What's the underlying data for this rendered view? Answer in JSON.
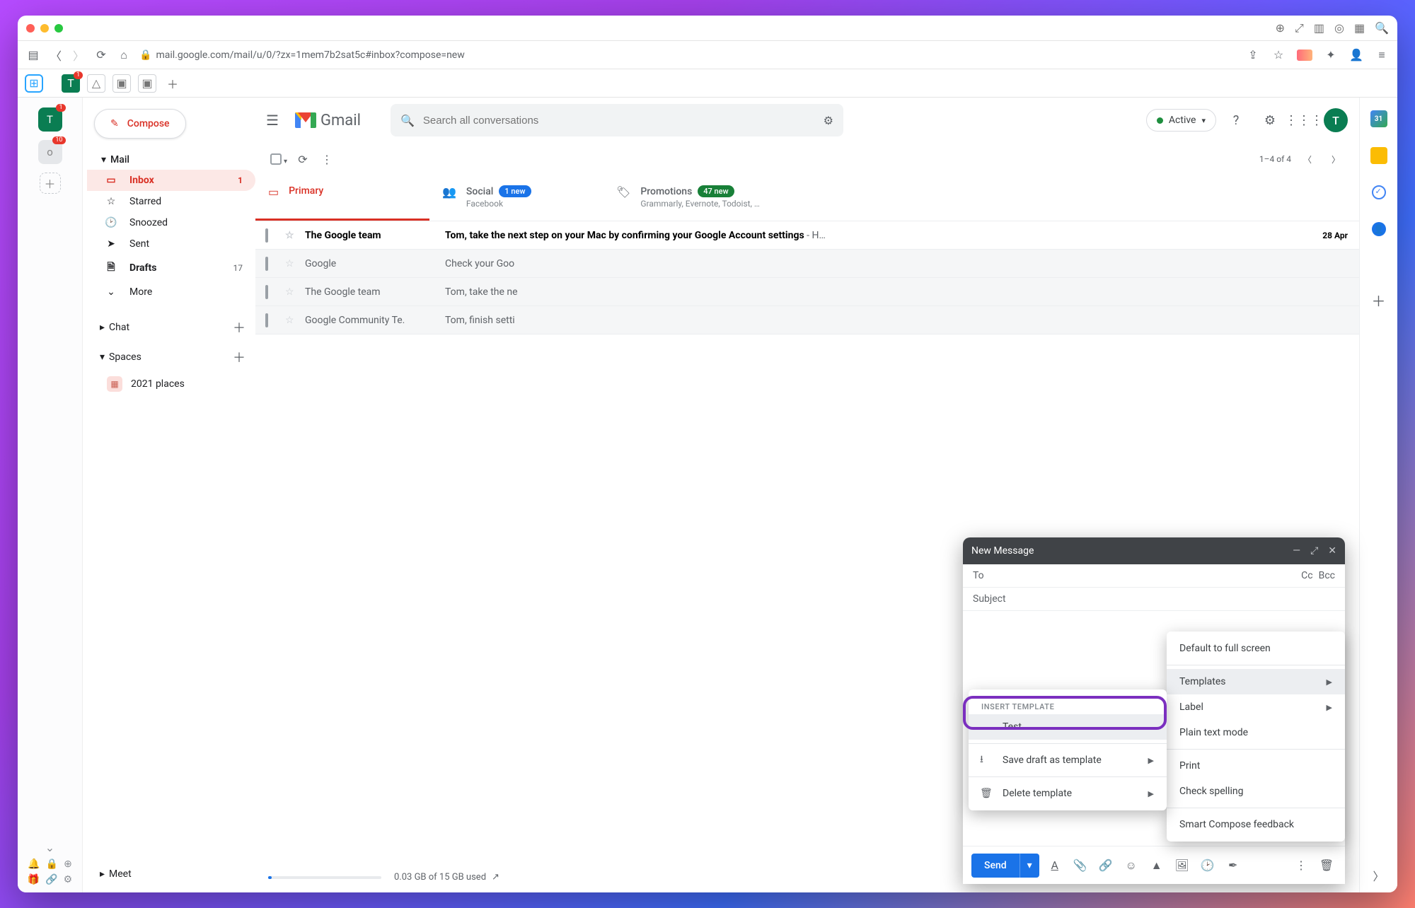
{
  "browser": {
    "url": "mail.google.com/mail/u/0/?zx=1mem7b2sat5c#inbox?compose=new"
  },
  "app_rail": {
    "badge_T": "1",
    "badge_O": "10"
  },
  "gmail": {
    "product": "Gmail",
    "search_placeholder": "Search all conversations",
    "status_label": "Active",
    "avatar_initial": "T"
  },
  "compose_btn": "Compose",
  "nav": {
    "mail_label": "Mail",
    "items": [
      {
        "icon": "inbox",
        "label": "Inbox",
        "count": "1",
        "active": true
      },
      {
        "icon": "star",
        "label": "Starred"
      },
      {
        "icon": "clock",
        "label": "Snoozed"
      },
      {
        "icon": "send",
        "label": "Sent"
      },
      {
        "icon": "draft",
        "label": "Drafts",
        "count": "17",
        "bold": true
      },
      {
        "icon": "more",
        "label": "More"
      }
    ],
    "chat_label": "Chat",
    "spaces_label": "Spaces",
    "space_item": "2021 places",
    "meet_label": "Meet"
  },
  "toolbar": {
    "range": "1–4 of 4"
  },
  "tabs": {
    "primary": "Primary",
    "social": "Social",
    "social_badge": "1 new",
    "social_sub": "Facebook",
    "promotions": "Promotions",
    "promo_badge": "47 new",
    "promo_sub": "Grammarly, Evernote, Todoist, …"
  },
  "emails": [
    {
      "sender": "The Google team",
      "subject": "Tom, take the next step on your Mac by confirming your Google Account settings",
      "preview": " - H…",
      "date": "28 Apr",
      "unread": true
    },
    {
      "sender": "Google",
      "subject": "Check your Goo",
      "date": "",
      "unread": false
    },
    {
      "sender": "The Google team",
      "subject": "Tom, take the ne",
      "date": "",
      "unread": false
    },
    {
      "sender": "Google Community Te.",
      "subject": "Tom, finish setti",
      "date": "",
      "unread": false
    }
  ],
  "storage": {
    "text": "0.03 GB of 15 GB used"
  },
  "compose": {
    "title": "New Message",
    "to_label": "To",
    "cc": "Cc",
    "bcc": "Bcc",
    "subject_placeholder": "Subject",
    "send": "Send"
  },
  "more_menu": {
    "default_fs": "Default to full screen",
    "templates": "Templates",
    "label": "Label",
    "plain": "Plain text mode",
    "print": "Print",
    "spell": "Check spelling",
    "smart": "Smart Compose feedback"
  },
  "template_menu": {
    "header": "INSERT TEMPLATE",
    "test": "Test",
    "save_as": "Save draft as template",
    "delete": "Delete template"
  },
  "addon_cal": "31"
}
